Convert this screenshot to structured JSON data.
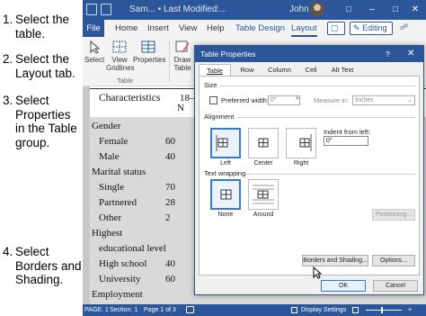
{
  "steps": [
    {
      "num": "1.",
      "text": "Select the table."
    },
    {
      "num": "2.",
      "text": "Select the Layout tab."
    },
    {
      "num": "3.",
      "text": "Select Properties in the Table group."
    },
    {
      "num": "4.",
      "text": "Select Borders and Shading."
    }
  ],
  "titlebar": {
    "doc_title": "Sam... • Last Modified:...",
    "user": "John O",
    "accent": "#2b579a"
  },
  "tabs": {
    "file": "File",
    "home": "Home",
    "insert": "Insert",
    "view": "View",
    "help": "Help",
    "table_design": "Table Design",
    "layout": "Layout",
    "editing": "Editing"
  },
  "ribbon": {
    "select": "Select",
    "view_gridlines": "View Gridlines",
    "properties": "Properties",
    "draw_table": "Draw Table",
    "group_table": "Table"
  },
  "document": {
    "header_col1": "Characteristics",
    "header_col2": "18–",
    "header_col2b": "N",
    "rows": [
      {
        "label": "Gender",
        "value": "",
        "indent": false
      },
      {
        "label": "Female",
        "value": "60",
        "indent": true
      },
      {
        "label": "Male",
        "value": "40",
        "indent": true
      },
      {
        "label": "Marital status",
        "value": "",
        "indent": false
      },
      {
        "label": "Single",
        "value": "70",
        "indent": true
      },
      {
        "label": "Partnered",
        "value": "28",
        "indent": true
      },
      {
        "label": "Other",
        "value": "2",
        "indent": true
      },
      {
        "label": "Highest",
        "value": "",
        "indent": false
      },
      {
        "label": "educational level",
        "value": "",
        "indent": true
      },
      {
        "label": "High school",
        "value": "40",
        "indent": true
      },
      {
        "label": "University",
        "value": "60",
        "indent": true
      },
      {
        "label": "Employment",
        "value": "",
        "indent": false
      }
    ]
  },
  "status": {
    "page": "PAGE: 1",
    "section": "Section: 1",
    "page_of": "Page 1 of 3",
    "display_settings": "Display Settings"
  },
  "dialog": {
    "title": "Table Properties",
    "help": "?",
    "close": "✕",
    "tabs": [
      "Table",
      "Row",
      "Column",
      "Cell",
      "Alt Text"
    ],
    "size_label": "Size",
    "preferred_width": "Preferred width:",
    "preferred_value": "0\"",
    "measure_in": "Measure in:",
    "measure_value": "Inches",
    "alignment_label": "Alignment",
    "indent_label": "Indent from left:",
    "indent_value": "0\"",
    "align_options": [
      "Left",
      "Center",
      "Right"
    ],
    "wrapping_label": "Text wrapping",
    "wrap_options": [
      "None",
      "Around"
    ],
    "positioning": "Positioning...",
    "borders_shading": "Borders and Shading...",
    "options": "Options...",
    "ok": "OK",
    "cancel": "Cancel"
  }
}
